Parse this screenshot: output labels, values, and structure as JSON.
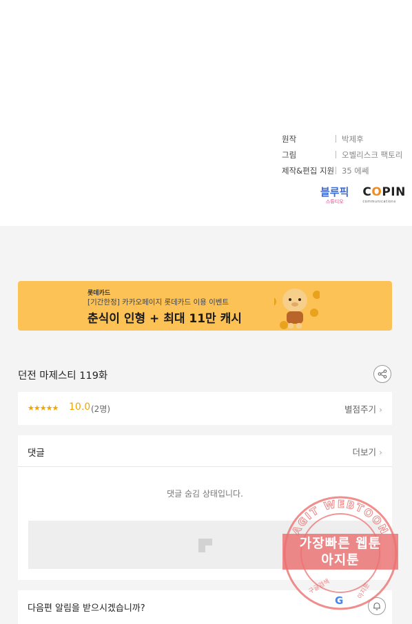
{
  "credits": [
    {
      "label": "원작",
      "value": "박제후"
    },
    {
      "label": "그림",
      "value": "오벨리스크 팩토리"
    },
    {
      "label": "제작&편집 지원",
      "value": "35 에쎄"
    }
  ],
  "logos": {
    "bluepick_main": "블루픽",
    "bluepick_sub": "스튜디오",
    "copin_main_prefix": "C",
    "copin_main_o": "O",
    "copin_main_suffix": "PIN",
    "copin_sub": "communications"
  },
  "banner": {
    "brand": "롯데카드",
    "subtitle": "[기간한정] 카카오페이지 롯데카드 이용 이벤트",
    "headline": "춘식이 인형 + 최대 11만 캐시"
  },
  "episode": {
    "title": "던전 마제스티 119화"
  },
  "rating": {
    "stars": "★★★★★",
    "score": "10.0",
    "count": "(2명)",
    "rate_link": "별점주기"
  },
  "comments": {
    "heading": "댓글",
    "more_link": "더보기",
    "hidden_message": "댓글 숨김 상태입니다."
  },
  "notify": {
    "question": "다음편 알림을 받으시겠습니까?"
  },
  "watermark": {
    "ring_text": "AGIT WEBTOON",
    "line1": "가장빠른 웹툰",
    "line2": "아지툰",
    "bottom_left": "구글검색",
    "bottom_right": "아지툰",
    "google_letter": "G"
  },
  "colors": {
    "banner_bg": "#fcc256",
    "rating_accent": "#f0a500",
    "watermark": "#ec7070",
    "page_bg": "#f4f4f4"
  }
}
